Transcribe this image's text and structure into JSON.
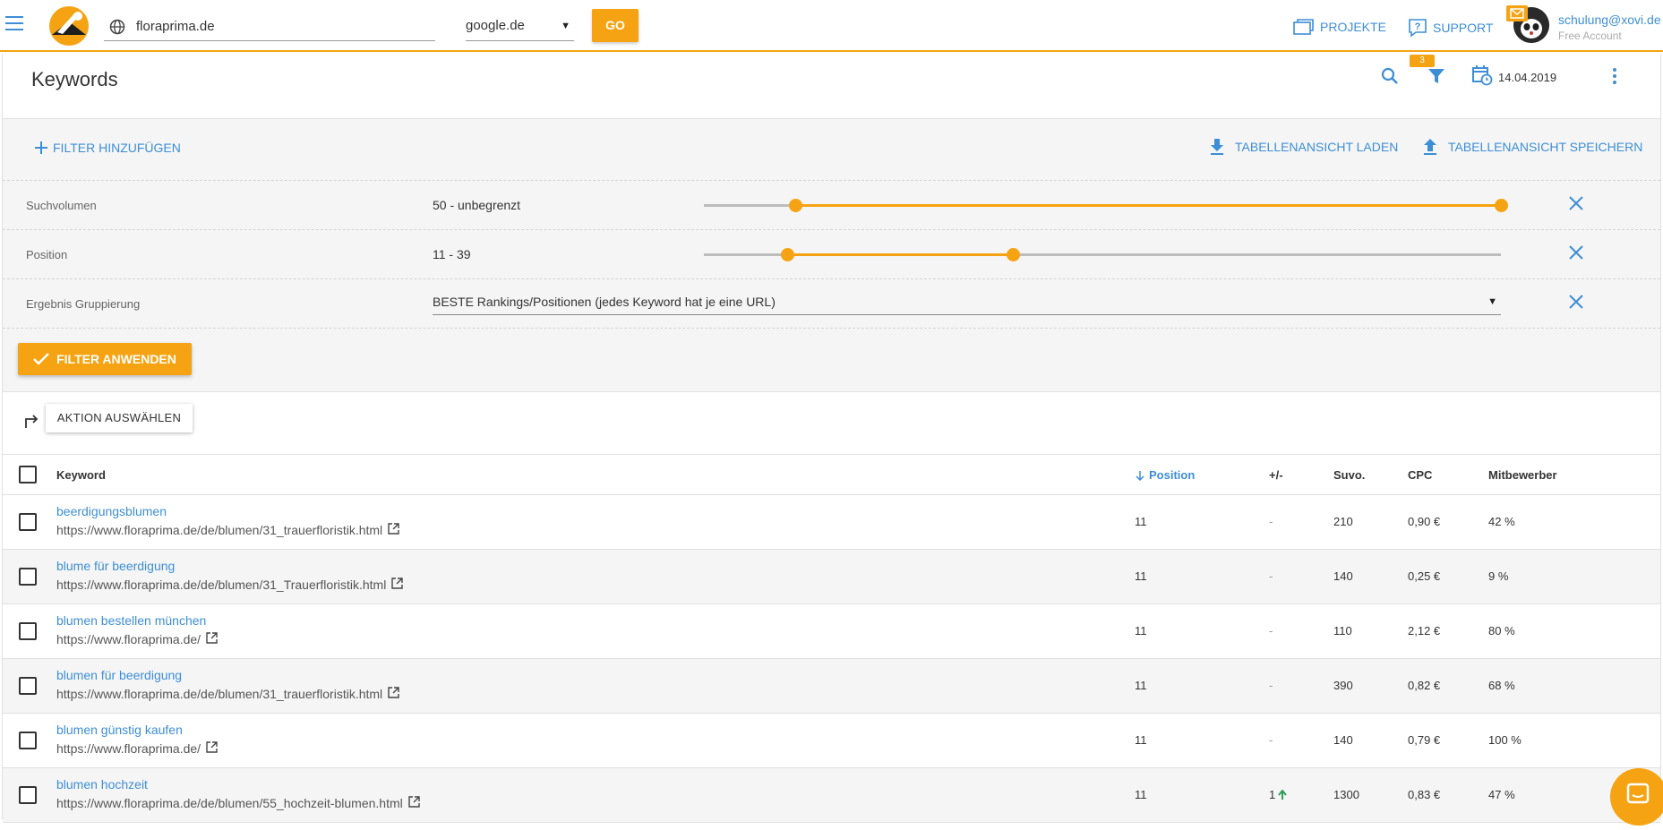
{
  "topbar": {
    "domain_value": "floraprima.de",
    "engine_value": "google.de",
    "go_label": "GO",
    "projects_label": "PROJEKTE",
    "support_label": "SUPPORT",
    "user_email": "schulung@xovi.de",
    "user_plan": "Free Account"
  },
  "header": {
    "title": "Keywords",
    "filter_count": "3",
    "date": "14.04.2019"
  },
  "filters": {
    "add_label": "FILTER HINZUFÜGEN",
    "load_view_label": "TABELLENANSICHT LADEN",
    "save_view_label": "TABELLENANSICHT SPEICHERN",
    "rows": [
      {
        "label": "Suchvolumen",
        "value": "50 - unbegrenzt",
        "range_start": 0.115,
        "range_end": 1.0
      },
      {
        "label": "Position",
        "value": "11 - 39",
        "range_start": 0.105,
        "range_end": 0.388
      },
      {
        "label": "Ergebnis Gruppierung",
        "value": "BESTE Rankings/Positionen (jedes Keyword hat je eine URL)"
      }
    ],
    "apply_label": "FILTER ANWENDEN"
  },
  "actions": {
    "select_label": "AKTION AUSWÄHLEN"
  },
  "table": {
    "headers": {
      "keyword": "Keyword",
      "position": "Position",
      "change": "+/-",
      "volume": "Suvo.",
      "cpc": "CPC",
      "competition": "Mitbewerber"
    },
    "rows": [
      {
        "keyword": "beerdigungsblumen",
        "url": "https://www.floraprima.de/de/blumen/31_trauerfloristik.html",
        "position": "11",
        "change": "-",
        "volume": "210",
        "cpc": "0,90 €",
        "competition": "42 %"
      },
      {
        "keyword": "blume für beerdigung",
        "url": "https://www.floraprima.de/de/blumen/31_Trauerfloristik.html",
        "position": "11",
        "change": "-",
        "volume": "140",
        "cpc": "0,25 €",
        "competition": "9 %"
      },
      {
        "keyword": "blumen bestellen münchen",
        "url": "https://www.floraprima.de/",
        "position": "11",
        "change": "-",
        "volume": "110",
        "cpc": "2,12 €",
        "competition": "80 %"
      },
      {
        "keyword": "blumen für beerdigung",
        "url": "https://www.floraprima.de/de/blumen/31_trauerfloristik.html",
        "position": "11",
        "change": "-",
        "volume": "390",
        "cpc": "0,82 €",
        "competition": "68 %"
      },
      {
        "keyword": "blumen günstig kaufen",
        "url": "https://www.floraprima.de/",
        "position": "11",
        "change": "-",
        "volume": "140",
        "cpc": "0,79 €",
        "competition": "100 %"
      },
      {
        "keyword": "blumen hochzeit",
        "url": "https://www.floraprima.de/de/blumen/55_hochzeit-blumen.html",
        "position": "11",
        "change": "1",
        "volume": "1300",
        "cpc": "0,83 €",
        "competition": "47 %"
      }
    ]
  },
  "colors": {
    "accent": "#f5a312",
    "link": "#3d8ed5",
    "up": "#2e9e58"
  }
}
